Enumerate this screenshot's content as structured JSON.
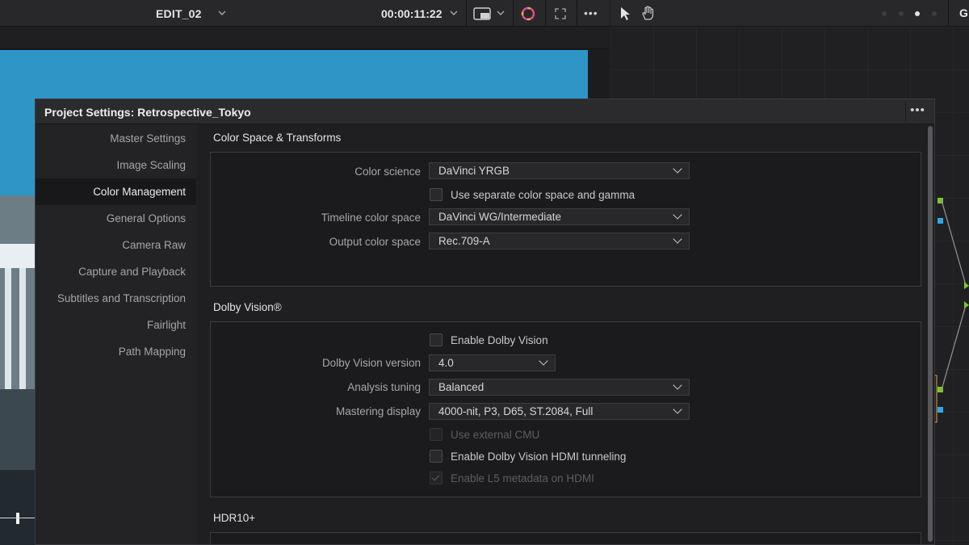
{
  "viewer": {
    "timeline_name": "EDIT_02",
    "timecode": "00:00:11:22"
  },
  "node_editor": {
    "label_initial": "G"
  },
  "dialog": {
    "title": "Project Settings:  Retrospective_Tokyo",
    "more_label": "•••"
  },
  "sidebar": {
    "items": [
      {
        "label": "Master Settings"
      },
      {
        "label": "Image Scaling"
      },
      {
        "label": "Color Management",
        "active": true
      },
      {
        "label": "General Options"
      },
      {
        "label": "Camera Raw"
      },
      {
        "label": "Capture and Playback"
      },
      {
        "label": "Subtitles and Transcription"
      },
      {
        "label": "Fairlight"
      },
      {
        "label": "Path Mapping"
      }
    ]
  },
  "color_space": {
    "section_title": "Color Space & Transforms",
    "color_science_label": "Color science",
    "color_science_value": "DaVinci YRGB",
    "separate_cs_label": "Use separate color space and gamma",
    "timeline_cs_label": "Timeline color space",
    "timeline_cs_value": "DaVinci WG/Intermediate",
    "output_cs_label": "Output color space",
    "output_cs_value": "Rec.709-A"
  },
  "dolby": {
    "section_title": "Dolby Vision®",
    "enable_label": "Enable Dolby Vision",
    "version_label": "Dolby Vision version",
    "version_value": "4.0",
    "tuning_label": "Analysis tuning",
    "tuning_value": "Balanced",
    "mastering_label": "Mastering display",
    "mastering_value": "4000-nit, P3, D65, ST.2084, Full",
    "external_cmu_label": "Use external CMU",
    "hdmi_tunnel_label": "Enable Dolby Vision HDMI tunneling",
    "l5_label": "Enable L5 metadata on HDMI"
  },
  "hdr10": {
    "section_title": "HDR10+"
  },
  "colors": {
    "accent_node_green": "#7bc62c",
    "accent_node_blue": "#2ea7e8",
    "viewer_sky": "#2d93c6"
  }
}
